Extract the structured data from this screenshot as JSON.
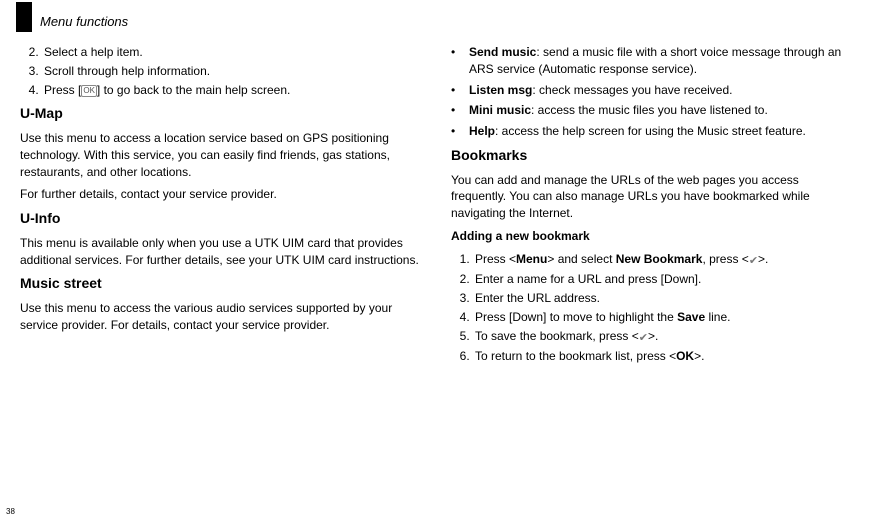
{
  "header": {
    "title": "Menu functions"
  },
  "pageNumber": "38",
  "left": {
    "steps_top": [
      "Select a help item.",
      "Scroll through help information.",
      "Press [  ] to go back to the main help screen."
    ],
    "step2_prefix": "Press [",
    "step2_glyph": "OK",
    "step2_suffix": "] to go back to the main help screen.",
    "umap_heading": "U-Map",
    "umap_p1": "Use this menu to access a location service based on GPS positioning technology. With this service, you can easily find friends, gas stations, restaurants, and other locations.",
    "umap_p2": "For further details, contact your service provider.",
    "uinfo_heading": "U-Info",
    "uinfo_p": "This menu is available only when you use a UTK UIM card that provides additional services. For further details, see your UTK UIM card instructions.",
    "music_heading": "Music street",
    "music_p": "Use this menu to access the various audio services supported by your service provider. For details, contact your service provider."
  },
  "right": {
    "features": [
      {
        "term": "Send music",
        "desc": ": send a music file with a short voice message through an ARS service (Automatic response service)."
      },
      {
        "term": "Listen msg",
        "desc": ": check messages you have received."
      },
      {
        "term": "Mini music",
        "desc": ": access the music files you have listened to."
      },
      {
        "term": "Help",
        "desc": ": access the help screen for using the Music street feature."
      }
    ],
    "bookmarks_heading": "Bookmarks",
    "bookmarks_p": "You can add and manage the URLs of the web pages you access frequently. You can also manage URLs you have bookmarked while navigating the Internet.",
    "adding_heading": "Adding a new bookmark",
    "add_steps": {
      "s1a": "Press <",
      "s1b": "Menu",
      "s1c": "> and select ",
      "s1d": "New Bookmark",
      "s1e": ", press <",
      "s1f": ">.",
      "s2": "Enter a name for a URL and press [Down].",
      "s3": "Enter the URL address.",
      "s4a": "Press [Down] to move to highlight the ",
      "s4b": "Save",
      "s4c": " line.",
      "s5a": "To save the bookmark, press <",
      "s5b": ">.",
      "s6a": "To return to the bookmark list, press <",
      "s6b": "OK",
      "s6c": ">."
    }
  }
}
